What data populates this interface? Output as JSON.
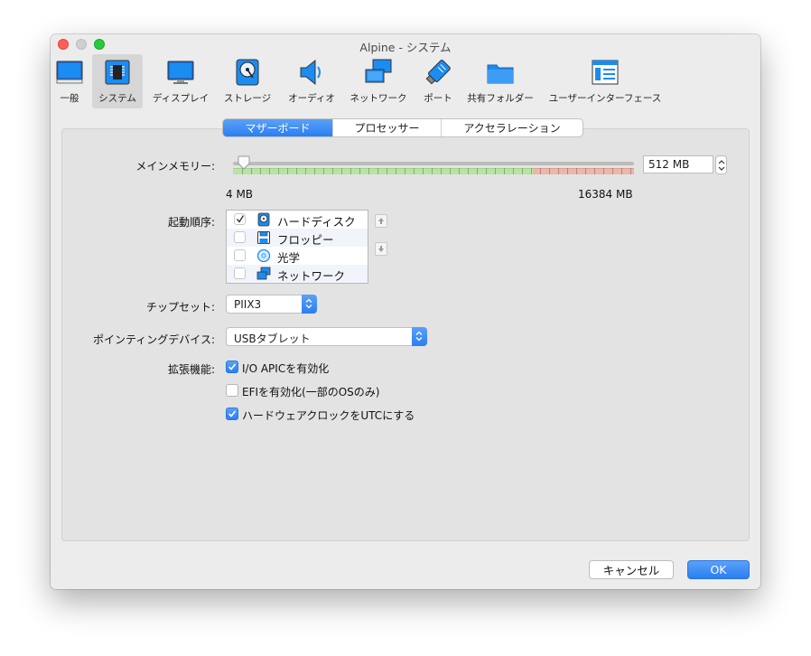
{
  "window": {
    "title": "Alpine - システム"
  },
  "toolbar": {
    "items": [
      {
        "label": "一般",
        "icon": "general-monitor-icon"
      },
      {
        "label": "システム",
        "icon": "system-chip-icon",
        "selected": true
      },
      {
        "label": "ディスプレイ",
        "icon": "display-monitor-icon"
      },
      {
        "label": "ストレージ",
        "icon": "storage-disk-icon"
      },
      {
        "label": "オーディオ",
        "icon": "audio-speaker-icon"
      },
      {
        "label": "ネットワーク",
        "icon": "network-icon"
      },
      {
        "label": "ポート",
        "icon": "port-plug-icon"
      },
      {
        "label": "共有フォルダー",
        "icon": "shared-folder-icon"
      },
      {
        "label": "ユーザーインターフェース",
        "icon": "user-interface-icon"
      }
    ]
  },
  "tabs": [
    {
      "label": "マザーボード",
      "active": true
    },
    {
      "label": "プロセッサー",
      "active": false
    },
    {
      "label": "アクセラレーション",
      "active": false
    }
  ],
  "motherboard": {
    "memory": {
      "label": "メインメモリー:",
      "value": "512 MB",
      "value_mb": 512,
      "min_label": "4 MB",
      "max_label": "16384 MB",
      "min_mb": 4,
      "max_mb": 16384,
      "recommended_fraction": 0.75
    },
    "boot_order": {
      "label": "起動順序:",
      "items": [
        {
          "label": "ハードディスク",
          "checked": true,
          "icon": "hard-disk-icon"
        },
        {
          "label": "フロッピー",
          "checked": false,
          "icon": "floppy-icon"
        },
        {
          "label": "光学",
          "checked": false,
          "icon": "optical-disc-icon"
        },
        {
          "label": "ネットワーク",
          "checked": false,
          "icon": "network-icon"
        }
      ]
    },
    "chipset": {
      "label": "チップセット:",
      "value": "PIIX3"
    },
    "pointing_device": {
      "label": "ポインティングデバイス:",
      "value": "USBタブレット"
    },
    "extended": {
      "label": "拡張機能:",
      "options": [
        {
          "label": "I/O APICを有効化",
          "checked": true
        },
        {
          "label": "EFIを有効化(一部のOSのみ)",
          "checked": false
        },
        {
          "label": "ハードウェアクロックをUTCにする",
          "checked": true
        }
      ]
    }
  },
  "buttons": {
    "cancel": "キャンセル",
    "ok": "OK"
  },
  "colors": {
    "accent": "#2b7ef2",
    "slider_ok": "#b9e3a6",
    "slider_warn": "#ebb6ad"
  }
}
